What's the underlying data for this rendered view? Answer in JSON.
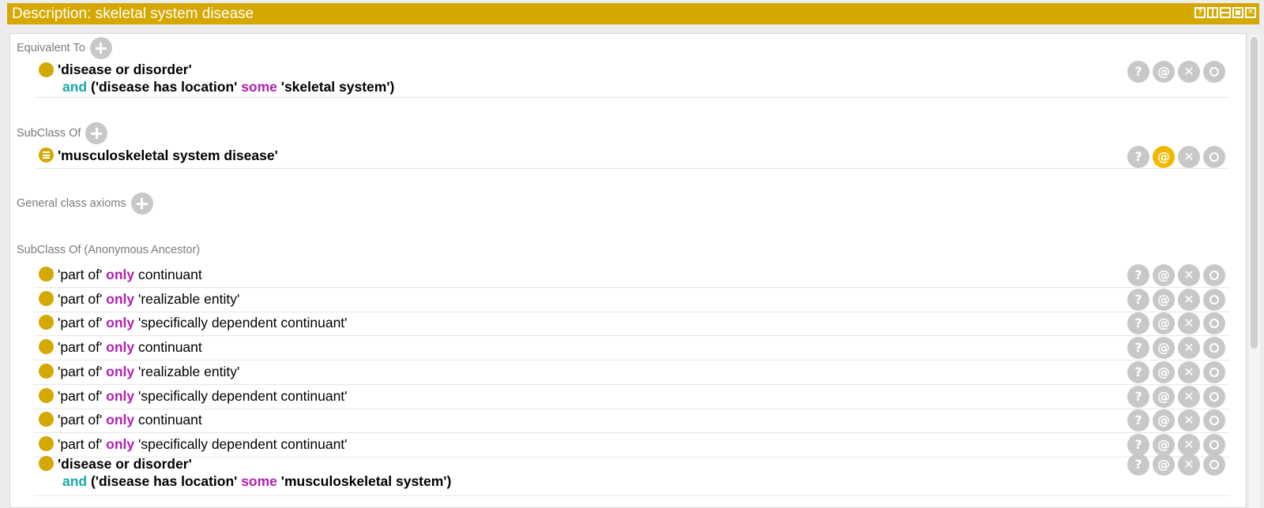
{
  "window": {
    "title": "Description: skeletal system disease",
    "buttons": [
      "?",
      "split-vertical",
      "split-horizontal",
      "maximize",
      "close"
    ]
  },
  "sections": {
    "equivalent_to": "Equivalent To",
    "subclass_of": "SubClass Of",
    "general_axioms": "General class axioms",
    "anonymous_ancestor": "SubClass Of (Anonymous Ancestor)"
  },
  "equivalent": {
    "line1": "'disease or disorder'",
    "and": "and",
    "open": "('disease has location' ",
    "some": "some",
    "rest": " 'skeletal system')"
  },
  "subclass": {
    "text": "'musculoskeletal system disease'"
  },
  "ancestors": [
    {
      "pre": "'part of' ",
      "kw": "only",
      "post": " continuant"
    },
    {
      "pre": "'part of' ",
      "kw": "only",
      "post": " 'realizable entity'"
    },
    {
      "pre": "'part of' ",
      "kw": "only",
      "post": " 'specifically dependent continuant'"
    },
    {
      "pre": "'part of' ",
      "kw": "only",
      "post": " continuant"
    },
    {
      "pre": "'part of' ",
      "kw": "only",
      "post": " 'realizable entity'"
    },
    {
      "pre": "'part of' ",
      "kw": "only",
      "post": " 'specifically dependent continuant'"
    },
    {
      "pre": "'part of' ",
      "kw": "only",
      "post": " continuant"
    },
    {
      "pre": "'part of' ",
      "kw": "only",
      "post": " 'specifically dependent continuant'"
    }
  ],
  "ancestor_last": {
    "line1": "'disease or disorder'",
    "and": "and",
    "open": "('disease has location' ",
    "some": "some",
    "rest": " 'musculoskeletal system')"
  },
  "actions": {
    "explain": "?",
    "annotate": "@",
    "delete": "✕"
  },
  "colors": {
    "accent": "#d4a800",
    "annotate_active": "#f2b800",
    "keyword_and": "#1aa8a8",
    "keyword_some_only": "#b020b0"
  }
}
